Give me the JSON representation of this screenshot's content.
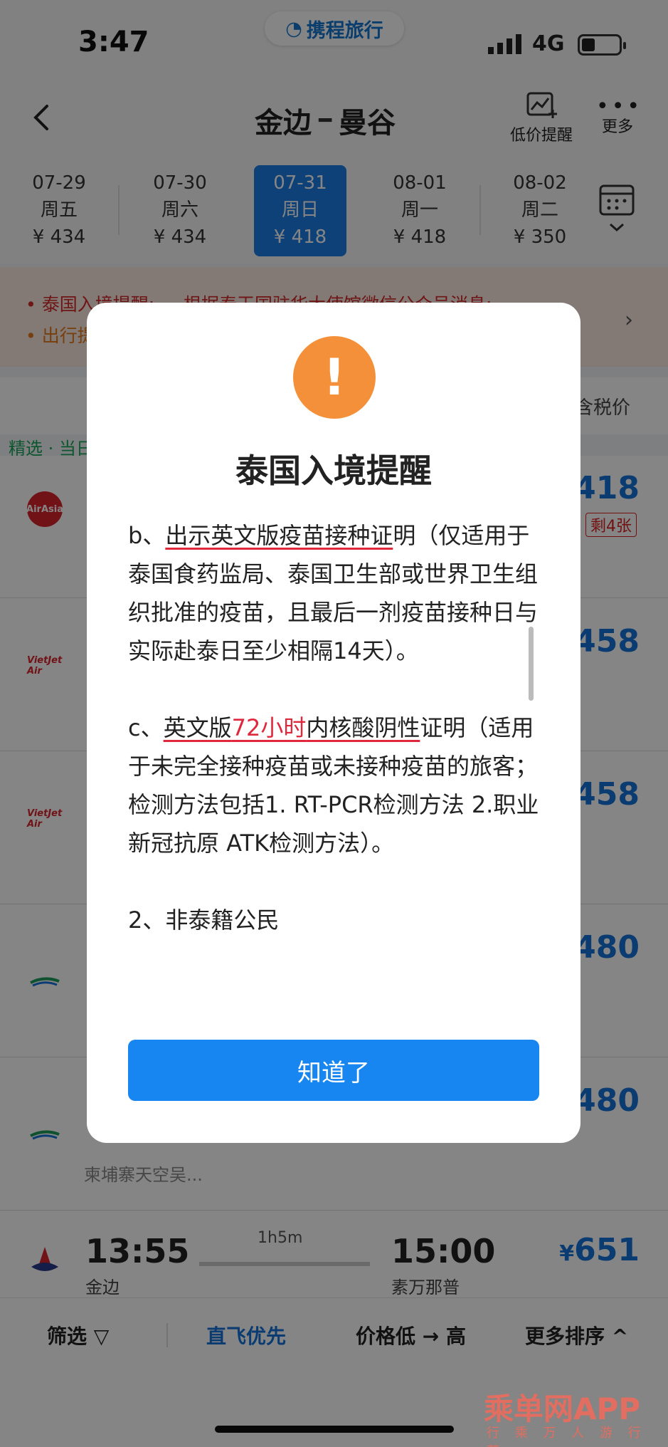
{
  "status": {
    "time": "3:47",
    "network": "4G",
    "brand": "携程旅行"
  },
  "nav": {
    "origin": "金边",
    "destination": "曼谷",
    "low_price_alert": "低价提醒",
    "more": "更多"
  },
  "dates": [
    {
      "date": "07-29",
      "weekday": "周五",
      "price": "¥ 434"
    },
    {
      "date": "07-30",
      "weekday": "周六",
      "price": "¥ 434"
    },
    {
      "date": "07-31",
      "weekday": "周日",
      "price": "¥ 418",
      "selected": true
    },
    {
      "date": "08-01",
      "weekday": "周一",
      "price": "¥ 418"
    },
    {
      "date": "08-02",
      "weekday": "周二",
      "price": "¥ 350"
    }
  ],
  "notice": {
    "line1": "• 泰国入境提醒: —  根据泰王国驻华大使馆微信公众号消息:",
    "line2": "• 出行提"
  },
  "list": {
    "tax_label": "含税价",
    "selected_tag": "精选 · 当日",
    "rows": [
      {
        "logo": "AirAsia",
        "price": "418",
        "badge": "剩4张"
      },
      {
        "logo": "VietJet Air",
        "price": "458"
      },
      {
        "logo": "VietJet Air",
        "price": "458"
      },
      {
        "logo": "",
        "price": "480"
      },
      {
        "logo": "",
        "price": "480",
        "airline": "柬埔寨天空吴..."
      },
      {
        "dep_time": "13:55",
        "dep_airport": "金边",
        "duration": "1h5m",
        "arr_time": "15:00",
        "arr_airport": "素万那普",
        "price": "651"
      }
    ]
  },
  "bottom": {
    "filter": "筛选",
    "direct": "直飞优先",
    "price_sort": "价格低 → 高",
    "more_sort": "更多排序"
  },
  "watermark": {
    "main": "乘单网APP",
    "sub": "行 乘 万 人 游 行 营"
  },
  "modal": {
    "title": "泰国入境提醒",
    "b_prefix": "b、",
    "b_under": "出示英文版疫苗接种证",
    "b_rest": "明（仅适用于泰国食药监局、泰国卫生部或世界卫生组织批准的疫苗，且最后一剂疫苗接种日与实际赴泰日至少相隔14天）。",
    "c_prefix": "c、",
    "c_under1": "英文版",
    "c_red": "72小时",
    "c_under2": "内核酸阴性",
    "c_rest": "证明（适用于未完全接种疫苗或未接种疫苗的旅客；检测方法包括1. RT-PCR检测方法 2.职业新冠抗原 ATK检测方法）。",
    "section2": "2、非泰籍公民",
    "ok": "知道了"
  },
  "colors": {
    "accent": "#1786f0",
    "warning": "#f5903a",
    "highlight_red": "#e0283c"
  }
}
